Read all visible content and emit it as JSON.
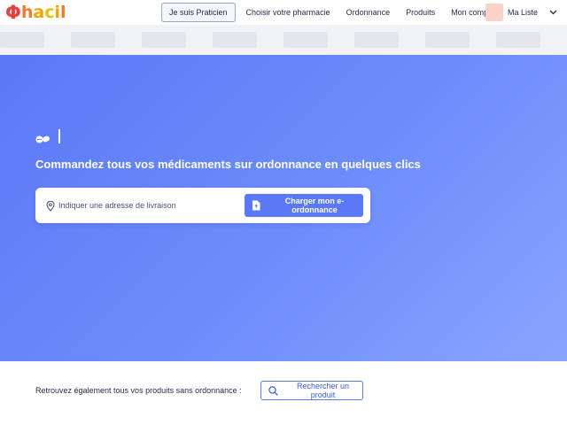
{
  "brand": {
    "logo_phi": "Φ",
    "logo_letters": [
      "h",
      "a",
      "c",
      "i",
      "l"
    ]
  },
  "nav": {
    "practitioner_label": "Je suis Praticien",
    "links": [
      "Choisir votre pharmacie",
      "Ordonnance",
      "Produits",
      "Mon compte"
    ],
    "list_label": "Ma Liste"
  },
  "hero": {
    "headline": "Commandez tous vos médicaments sur ordonnance en quelques clics",
    "address_placeholder": "Indiquer une adresse de livraison",
    "upload_label": "Charger mon e-ordonnance"
  },
  "footer_bar": {
    "text": "Retrouvez également tous vos produits sans ordonnance :",
    "search_label": "Rechercher un produit"
  },
  "icons": {
    "pills": "pills-icon",
    "pin": "location-pin-icon",
    "file": "file-upload-icon",
    "search": "search-icon",
    "chevron": "chevron-down-icon"
  },
  "colors": {
    "primary": "#5b79f6",
    "hero_end": "#8aa4ff",
    "logo_red": "#e8403e",
    "logo_orange": "#f07a2a",
    "logo_yellow": "#e9c100"
  }
}
